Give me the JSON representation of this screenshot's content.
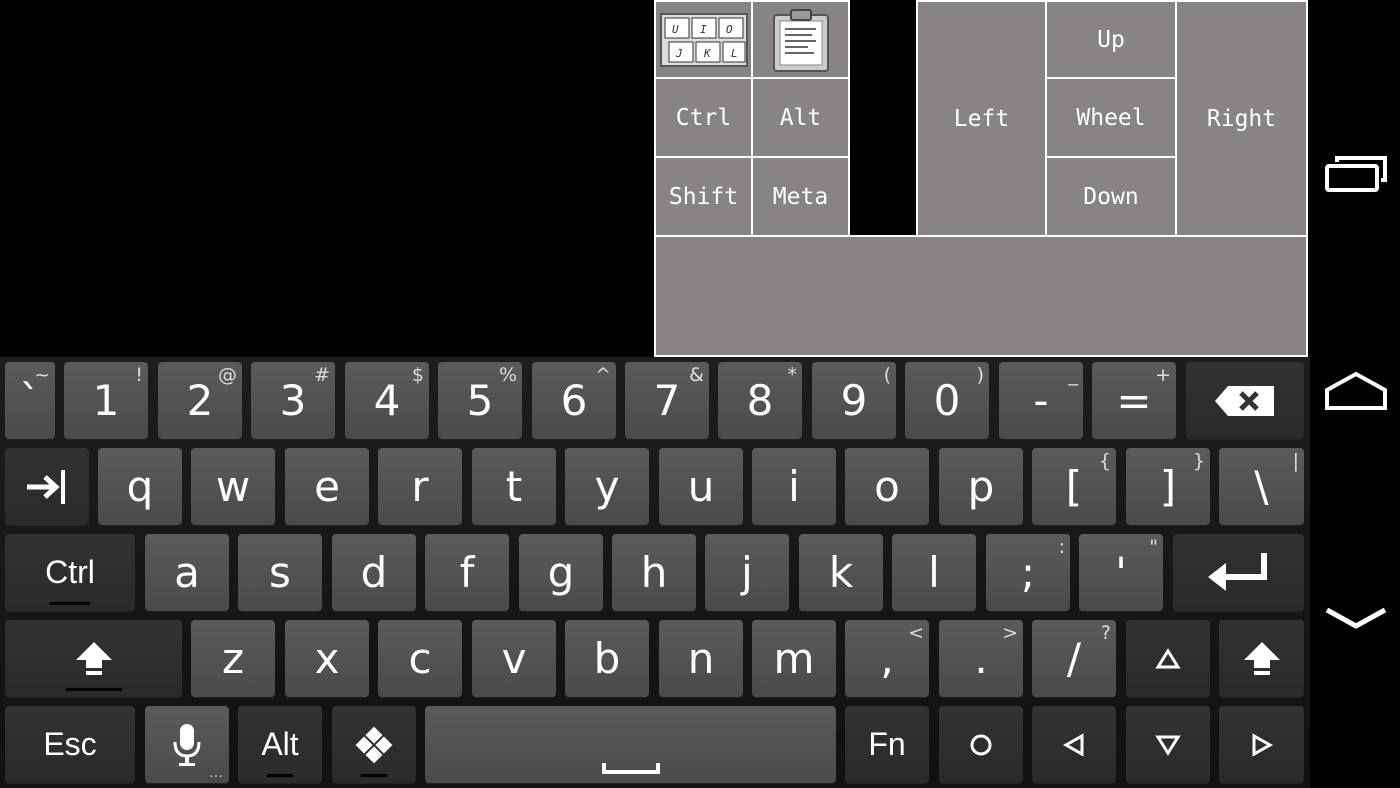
{
  "control_pad": {
    "keys": {
      "ctrl": "Ctrl",
      "alt": "Alt",
      "shift": "Shift",
      "meta": "Meta",
      "left": "Left",
      "up": "Up",
      "wheel": "Wheel",
      "down": "Down",
      "right": "Right"
    },
    "keyboard_thumb_letters": [
      "U",
      "I",
      "O",
      "J",
      "K",
      "L"
    ]
  },
  "keyboard": {
    "row1": [
      {
        "main": "`",
        "sub": "~"
      },
      {
        "main": "1",
        "sub": "!"
      },
      {
        "main": "2",
        "sub": "@"
      },
      {
        "main": "3",
        "sub": "#"
      },
      {
        "main": "4",
        "sub": "$"
      },
      {
        "main": "5",
        "sub": "%"
      },
      {
        "main": "6",
        "sub": "^"
      },
      {
        "main": "7",
        "sub": "&"
      },
      {
        "main": "8",
        "sub": "*"
      },
      {
        "main": "9",
        "sub": "("
      },
      {
        "main": "0",
        "sub": ")"
      },
      {
        "main": "-",
        "sub": "_"
      },
      {
        "main": "=",
        "sub": "+"
      }
    ],
    "row2": [
      {
        "main": "q"
      },
      {
        "main": "w"
      },
      {
        "main": "e"
      },
      {
        "main": "r"
      },
      {
        "main": "t"
      },
      {
        "main": "y"
      },
      {
        "main": "u"
      },
      {
        "main": "i"
      },
      {
        "main": "o"
      },
      {
        "main": "p"
      },
      {
        "main": "[",
        "sub": "{"
      },
      {
        "main": "]",
        "sub": "}"
      },
      {
        "main": "\\",
        "sub": "|"
      }
    ],
    "row3": [
      {
        "main": "a"
      },
      {
        "main": "s"
      },
      {
        "main": "d"
      },
      {
        "main": "f"
      },
      {
        "main": "g"
      },
      {
        "main": "h"
      },
      {
        "main": "j"
      },
      {
        "main": "k"
      },
      {
        "main": "l"
      },
      {
        "main": ";",
        "sub": ":"
      },
      {
        "main": "'",
        "sub": "\""
      }
    ],
    "row4": [
      {
        "main": "z"
      },
      {
        "main": "x"
      },
      {
        "main": "c"
      },
      {
        "main": "v"
      },
      {
        "main": "b"
      },
      {
        "main": "n"
      },
      {
        "main": "m"
      },
      {
        "main": ",",
        "sub": "<"
      },
      {
        "main": ".",
        "sub": ">"
      },
      {
        "main": "/",
        "sub": "?"
      }
    ],
    "ctrl_label": "Ctrl",
    "esc_label": "Esc",
    "alt_label": "Alt",
    "fn_label": "Fn",
    "mic_more": "…"
  },
  "icons": {
    "backspace": "backspace-icon",
    "tab": "tab-icon",
    "enter": "enter-icon",
    "shift": "shift-icon",
    "mic": "microphone-icon",
    "win": "windows-icon",
    "space": "space-icon",
    "recents": "recent-apps-icon",
    "home": "home-icon",
    "back": "back-icon"
  }
}
